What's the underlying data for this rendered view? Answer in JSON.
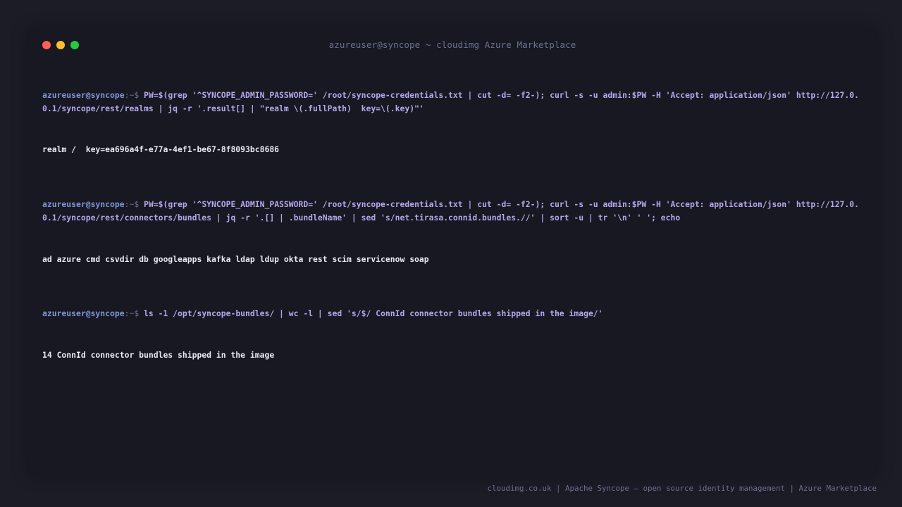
{
  "window": {
    "title": "azureuser@syncope ~ cloudimg Azure Marketplace",
    "buttons": {
      "close_color": "#ff5f57",
      "minimize_color": "#febc2e",
      "maximize_color": "#28c840"
    }
  },
  "prompt": {
    "user_host": "azureuser@syncope",
    "suffix": ":~$ "
  },
  "terminal": {
    "entries": [
      {
        "command": "PW=$(grep '^SYNCOPE_ADMIN_PASSWORD=' /root/syncope-credentials.txt | cut -d= -f2-); curl -s -u admin:$PW -H 'Accept: application/json' http://127.0.0.1/syncope/rest/realms | jq -r '.result[] | \"realm \\(.fullPath)  key=\\(.key)\"'",
        "output": "realm /  key=ea696a4f-e77a-4ef1-be67-8f8093bc8686"
      },
      {
        "command": "PW=$(grep '^SYNCOPE_ADMIN_PASSWORD=' /root/syncope-credentials.txt | cut -d= -f2-); curl -s -u admin:$PW -H 'Accept: application/json' http://127.0.0.1/syncope/rest/connectors/bundles | jq -r '.[] | .bundleName' | sed 's/net.tirasa.connid.bundles.//' | sort -u | tr '\\n' ' '; echo",
        "output": "ad azure cmd csvdir db googleapps kafka ldap ldup okta rest scim servicenow soap"
      },
      {
        "command": "ls -1 /opt/syncope-bundles/ | wc -l | sed 's/$/ ConnId connector bundles shipped in the image/'",
        "output": "14 ConnId connector bundles shipped in the image"
      }
    ]
  },
  "footer": {
    "text": "cloudimg.co.uk | Apache Syncope — open source identity management | Azure Marketplace"
  }
}
